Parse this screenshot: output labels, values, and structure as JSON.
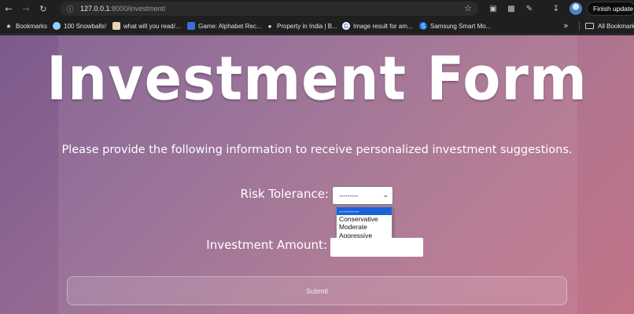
{
  "browser": {
    "url_host": "127.0.0.1",
    "url_rest": ":8000/investment/",
    "finish_update_label": "Finish update"
  },
  "bookmarks": {
    "items": [
      {
        "label": "Bookmarks",
        "icon": "star-icon"
      },
      {
        "label": "100 Snowballs!",
        "icon": "snowball-favicon"
      },
      {
        "label": "what will you read/...",
        "icon": "book-favicon"
      },
      {
        "label": "Game: Alphabet Rec...",
        "icon": "game-favicon"
      },
      {
        "label": "Property in India | B...",
        "icon": "globe-icon"
      },
      {
        "label": "Image result for am...",
        "icon": "google-favicon"
      },
      {
        "label": "Samsung Smart Mo...",
        "icon": "samsung-favicon"
      }
    ],
    "all_bookmarks_label": "All Bookmarks"
  },
  "form": {
    "title": "Investment Form",
    "subtitle": "Please provide the following information to receive personalized investment suggestions.",
    "risk_label": "Risk Tolerance:",
    "risk_selected": "---------",
    "risk_options": [
      "---------",
      "Conservative",
      "Moderate",
      "Aggressive"
    ],
    "amount_label": "Investment Amount:",
    "amount_value": "",
    "submit_label": "Submit"
  },
  "colors": {
    "accent_selected_option": "#1a62d9",
    "background_start": "#7b5a8c",
    "background_end": "#c17487"
  }
}
